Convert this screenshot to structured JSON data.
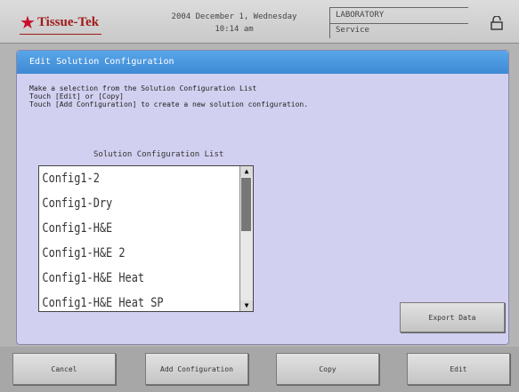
{
  "header": {
    "logo_text": "Tissue-Tek",
    "date": "2004  December  1,  Wednesday",
    "time": "10:14  am",
    "lab_title": "LABORATORY",
    "lab_sub": "Service"
  },
  "panel": {
    "title": "Edit Solution Configuration",
    "instructions": [
      "Make a selection from the Solution Configuration List",
      "Touch [Edit] or [Copy]",
      "Touch [Add Configuration] to create a new solution configuration."
    ],
    "list_label": "Solution Configuration List",
    "list_items": [
      "Config1-2",
      "Config1-Dry",
      "Config1-H&E",
      "Config1-H&E 2",
      "Config1-H&E Heat",
      "Config1-H&E Heat SP"
    ],
    "export_label": "Export Data"
  },
  "bottom": {
    "cancel": "Cancel",
    "add": "Add Configuration",
    "copy": "Copy",
    "edit": "Edit"
  }
}
